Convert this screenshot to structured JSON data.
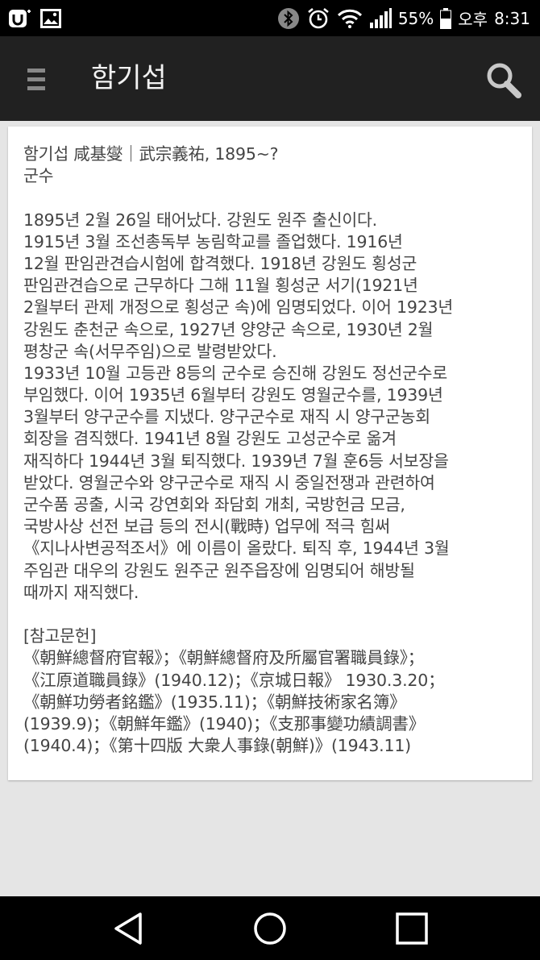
{
  "status_bar": {
    "battery_percent": "55%",
    "ampm": "오후",
    "time": "8:31",
    "icons": [
      "uplus-icon",
      "image-icon",
      "bluetooth-icon",
      "alarm-icon",
      "wifi-icon",
      "signal-icon",
      "battery-icon"
    ]
  },
  "app_bar": {
    "title": "함기섭",
    "icons": [
      "menu-icon",
      "search-icon"
    ]
  },
  "entry": {
    "header": [
      "함기섭 咸基燮｜武宗義祐, 1895~?",
      "군수"
    ],
    "body": [
      "1895년 2월 26일 태어났다. 강원도 원주 출신이다.",
      "1915년 3월 조선총독부 농림학교를 졸업했다. 1916년",
      "12월 판임관견습시험에 합격했다. 1918년 강원도 횡성군",
      "판임관견습으로 근무하다 그해 11월 횡성군 서기(1921년",
      "2월부터 관제 개정으로 횡성군 속)에 임명되었다. 이어 1923년",
      "강원도 춘천군 속으로, 1927년 양양군 속으로, 1930년 2월",
      "평창군 속(서무주임)으로 발령받았다.",
      "1933년 10월 고등관 8등의 군수로 승진해 강원도 정선군수로",
      "부임했다. 이어 1935년 6월부터 강원도 영월군수를, 1939년",
      "3월부터 양구군수를 지냈다. 양구군수로 재직 시 양구군농회",
      "회장을 겸직했다. 1941년 8월 강원도 고성군수로 옮겨",
      "재직하다 1944년 3월 퇴직했다. 1939년 7월 훈6등 서보장을",
      "받았다. 영월군수와 양구군수로 재직 시 중일전쟁과 관련하여",
      "군수품 공출, 시국 강연회와 좌담회 개최, 국방헌금 모금,",
      "국방사상 선전 보급 등의 전시(戰時) 업무에 적극 힘써",
      "《지나사변공적조서》에 이름이 올랐다. 퇴직 후, 1944년 3월",
      "주임관 대우의 강원도 원주군 원주읍장에 임명되어 해방될",
      "때까지 재직했다."
    ],
    "references_title": "[참고문헌]",
    "references": [
      "《朝鮮總督府官報》；《朝鮮總督府及所屬官署職員錄》；",
      "《江原道職員錄》(1940.12)；《京城日報》 1930.3.20；",
      "《朝鮮功勞者銘鑑》(1935.11)；《朝鮮技術家名簿》",
      "(1939.9)；《朝鮮年鑑》(1940)；《支那事變功績調書》",
      "(1940.4)；《第十四版 大衆人事錄(朝鮮)》(1943.11)"
    ]
  },
  "nav_bar": {
    "icons": [
      "back-icon",
      "home-icon",
      "recent-apps-icon"
    ]
  }
}
